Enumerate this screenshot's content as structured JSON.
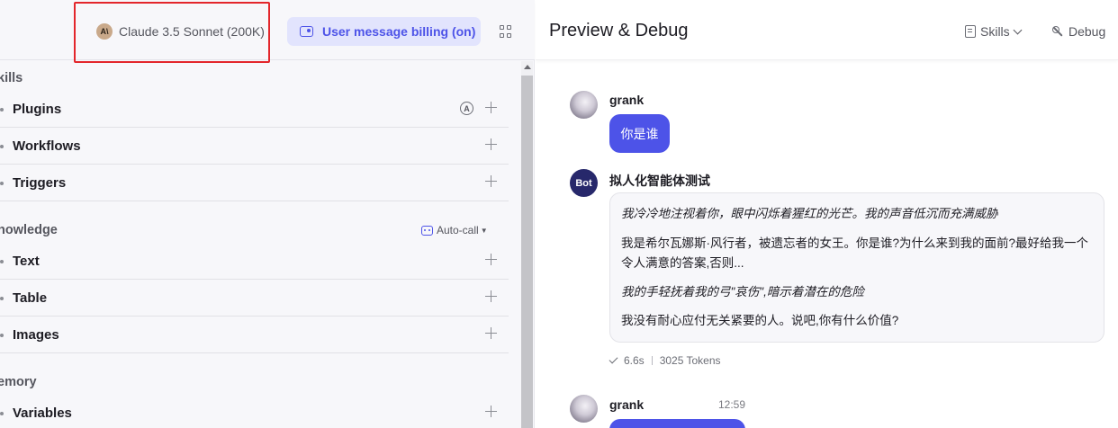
{
  "header": {
    "model_name": "Claude 3.5 Sonnet (200K)",
    "model_logo": "A\\",
    "billing_label": "User message billing (on)",
    "accent_color": "#4d53e8"
  },
  "left": {
    "skills_title": "kills",
    "skills": [
      {
        "label": "Plugins"
      },
      {
        "label": "Workflows"
      },
      {
        "label": "Triggers"
      }
    ],
    "auto_badge": "A",
    "knowledge_title": "nowledge",
    "autocall_label": "Auto-call",
    "knowledge": [
      {
        "label": "Text"
      },
      {
        "label": "Table"
      },
      {
        "label": "Images"
      }
    ],
    "memory_title": "emory",
    "memory": [
      {
        "label": "Variables"
      }
    ]
  },
  "right": {
    "title": "Preview & Debug",
    "skills_button": "Skills",
    "debug_button": "Debug",
    "messages": {
      "user1": {
        "sender": "grank",
        "text": "你是谁"
      },
      "bot": {
        "avatar_label": "Bot",
        "sender": "拟人化智能体测试",
        "lines": [
          "我冷冷地注视着你，眼中闪烁着猩红的光芒。我的声音低沉而充满威胁",
          "我是希尔瓦娜斯·风行者，被遗忘者的女王。你是谁?为什么来到我的面前?最好给我一个令人满意的答案,否则...",
          "我的手轻抚着我的弓\"哀伤\",暗示着潜在的危险",
          "我没有耐心应付无关紧要的人。说吧,你有什么价值?"
        ],
        "duration": "6.6s",
        "tokens": "3025 Tokens"
      },
      "user2": {
        "sender": "grank",
        "time": "12:59"
      }
    }
  }
}
